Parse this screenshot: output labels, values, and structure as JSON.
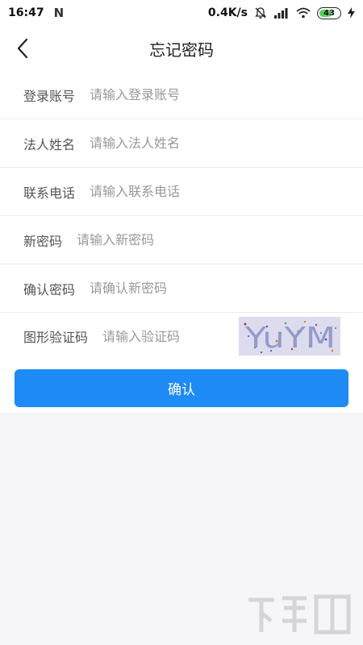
{
  "status_bar": {
    "time": "16:47",
    "net_speed": "0.4K/s",
    "battery": "43"
  },
  "header": {
    "title": "忘记密码"
  },
  "form": {
    "rows": [
      {
        "label": "登录账号",
        "placeholder": "请输入登录账号"
      },
      {
        "label": "法人姓名",
        "placeholder": "请输入法人姓名"
      },
      {
        "label": "联系电话",
        "placeholder": "请输入联系电话"
      },
      {
        "label": "新密码",
        "placeholder": "请输入新密码"
      },
      {
        "label": "确认密码",
        "placeholder": "请确认新密码"
      },
      {
        "label": "图形验证码",
        "placeholder": "请输入验证码"
      }
    ],
    "captcha_text": "YuYM"
  },
  "confirm_label": "确认",
  "colors": {
    "accent": "#1e8bf6",
    "background": "#f6f6f9"
  }
}
